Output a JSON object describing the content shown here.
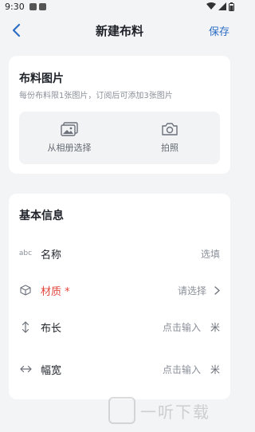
{
  "status": {
    "time": "9:30"
  },
  "nav": {
    "title": "新建布料",
    "save_label": "保存"
  },
  "images_card": {
    "title": "布料图片",
    "hint": "每份布料限1张图片，订阅后可添加3张图片",
    "album_label": "从相册选择",
    "camera_label": "拍照"
  },
  "basic_card": {
    "title": "基本信息",
    "rows": [
      {
        "icon": "abc-icon",
        "icon_text": "abc",
        "label": "名称",
        "value": "选填",
        "unit": ""
      },
      {
        "icon": "cube-icon",
        "label": "材质 *",
        "value": "请选择",
        "unit": ""
      },
      {
        "icon": "vertical-arrows-icon",
        "label": "布长",
        "value": "点击输入",
        "unit": "米"
      },
      {
        "icon": "horizontal-arrows-icon",
        "label": "幅宽",
        "value": "点击输入",
        "unit": "米"
      }
    ]
  },
  "watermark": {
    "text": "一听下载"
  },
  "colors": {
    "accent": "#2c6ec6",
    "required": "#e0483e",
    "background": "#f3f4f6"
  }
}
